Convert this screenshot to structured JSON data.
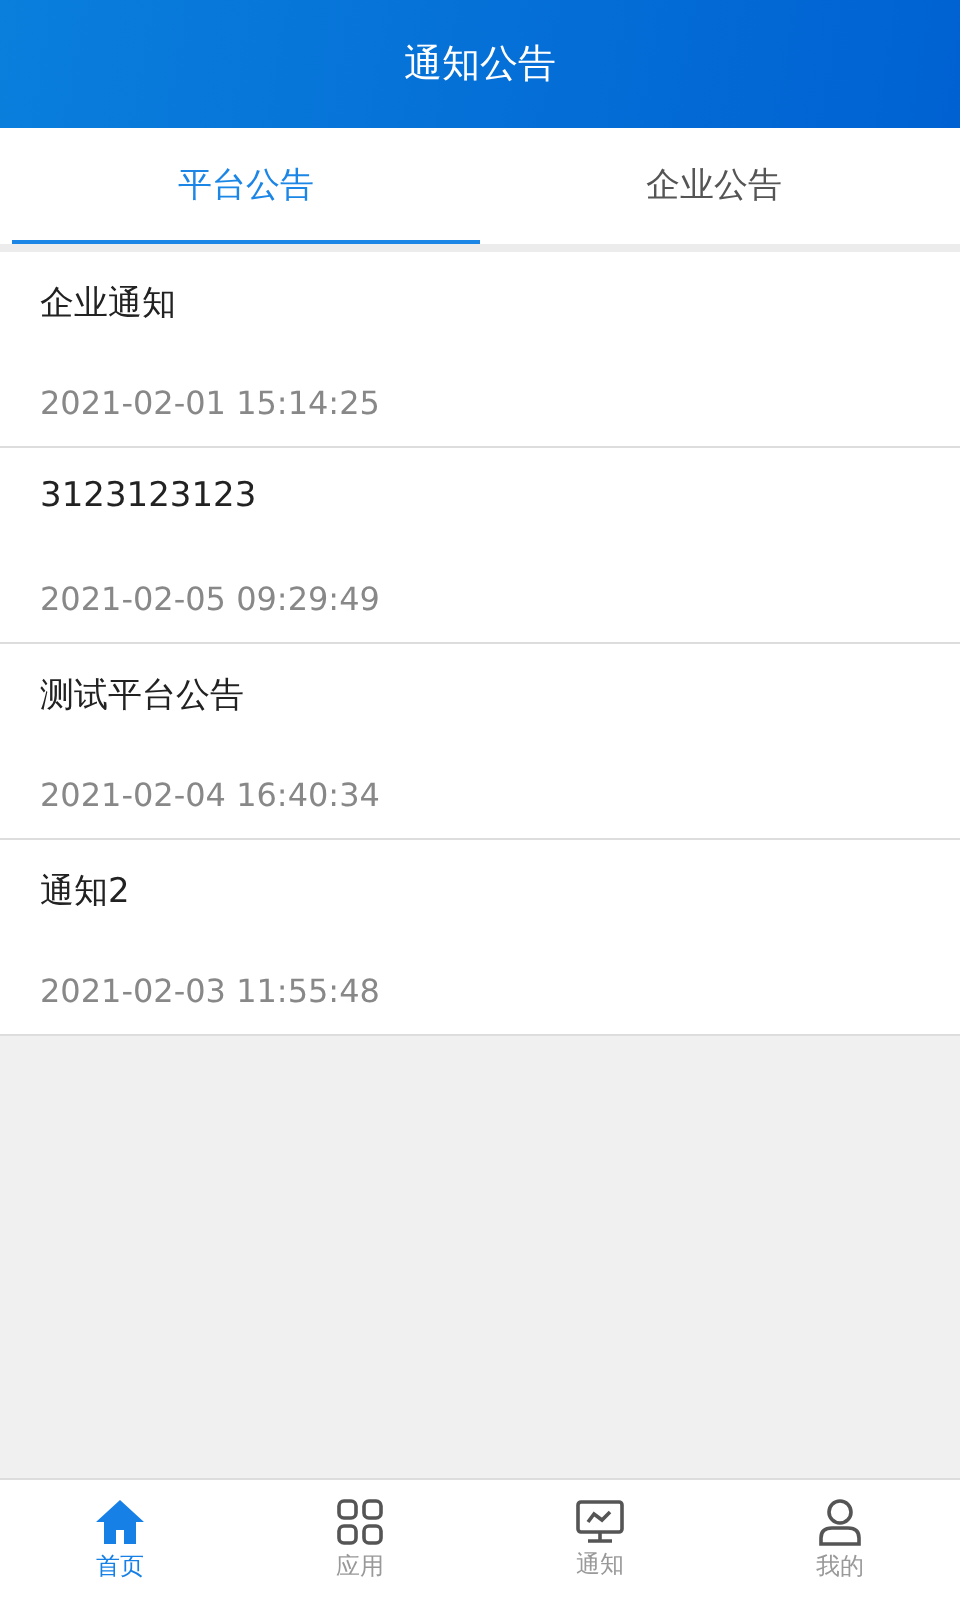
{
  "header": {
    "title": "通知公告"
  },
  "tabs": [
    {
      "label": "平台公告",
      "selected": true
    },
    {
      "label": "企业公告",
      "selected": false
    }
  ],
  "notices": [
    {
      "title": "企业通知",
      "time": "2021-02-01 15:14:25"
    },
    {
      "title": "3123123123",
      "time": "2021-02-05 09:29:49"
    },
    {
      "title": "测试平台公告",
      "time": "2021-02-04 16:40:34"
    },
    {
      "title": "通知2",
      "time": "2021-02-03 11:55:48"
    }
  ],
  "nav": [
    {
      "kind": "home",
      "label": "首页",
      "selected": true
    },
    {
      "kind": "apps",
      "label": "应用",
      "selected": false
    },
    {
      "kind": "monitor",
      "label": "通知",
      "selected": false
    },
    {
      "kind": "user",
      "label": "我的",
      "selected": false
    }
  ]
}
